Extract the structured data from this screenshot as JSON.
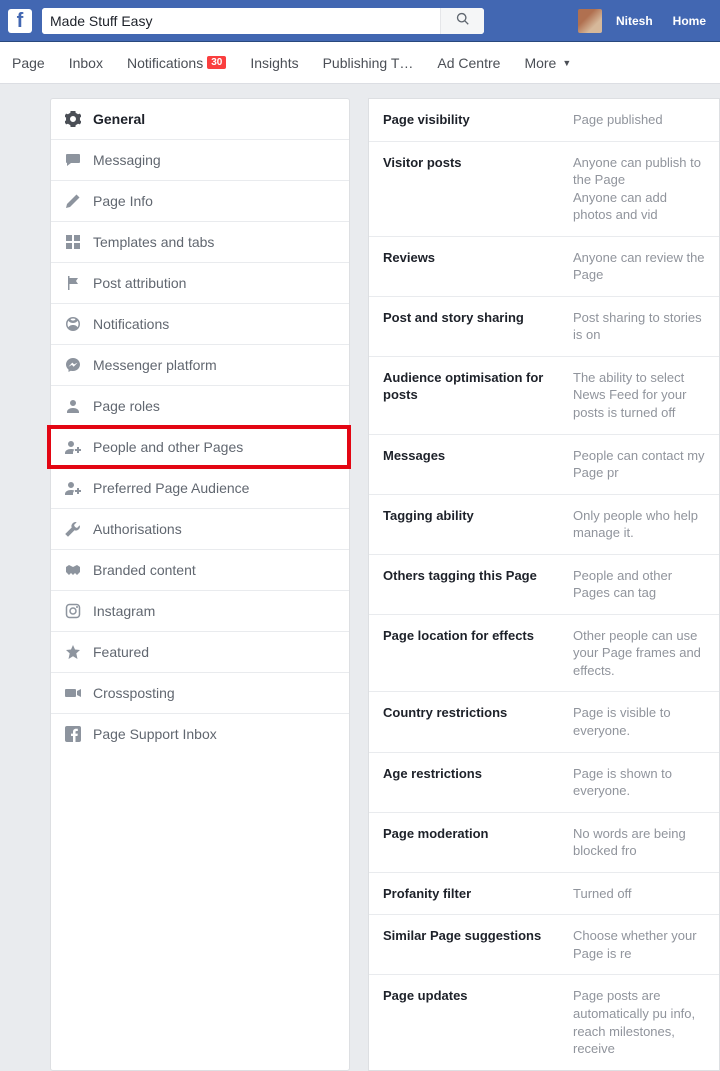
{
  "header": {
    "search_value": "Made Stuff Easy",
    "user_name": "Nitesh",
    "home_label": "Home"
  },
  "tabs": {
    "page": "Page",
    "inbox": "Inbox",
    "notifications": "Notifications",
    "notifications_badge": "30",
    "insights": "Insights",
    "publishing": "Publishing T…",
    "ad_centre": "Ad Centre",
    "more": "More"
  },
  "sidebar": [
    {
      "key": "general",
      "label": "General",
      "icon": "gear",
      "active": true
    },
    {
      "key": "messaging",
      "label": "Messaging",
      "icon": "chat"
    },
    {
      "key": "page-info",
      "label": "Page Info",
      "icon": "pencil"
    },
    {
      "key": "templates",
      "label": "Templates and tabs",
      "icon": "grid"
    },
    {
      "key": "post-attribution",
      "label": "Post attribution",
      "icon": "flag"
    },
    {
      "key": "notifications",
      "label": "Notifications",
      "icon": "globe"
    },
    {
      "key": "messenger-platform",
      "label": "Messenger platform",
      "icon": "messenger"
    },
    {
      "key": "page-roles",
      "label": "Page roles",
      "icon": "person"
    },
    {
      "key": "people-pages",
      "label": "People and other Pages",
      "icon": "person-plus",
      "highlight": true
    },
    {
      "key": "preferred-audience",
      "label": "Preferred Page Audience",
      "icon": "person-plus"
    },
    {
      "key": "authorisations",
      "label": "Authorisations",
      "icon": "wrench"
    },
    {
      "key": "branded-content",
      "label": "Branded content",
      "icon": "handshake"
    },
    {
      "key": "instagram",
      "label": "Instagram",
      "icon": "instagram"
    },
    {
      "key": "featured",
      "label": "Featured",
      "icon": "star"
    },
    {
      "key": "crossposting",
      "label": "Crossposting",
      "icon": "video"
    },
    {
      "key": "page-support",
      "label": "Page Support Inbox",
      "icon": "fb"
    }
  ],
  "settings_rows": [
    {
      "label": "Page visibility",
      "value": "Page published"
    },
    {
      "label": "Visitor posts",
      "value": "Anyone can publish to the Page\nAnyone can add photos and vid"
    },
    {
      "label": "Reviews",
      "value": "Anyone can review the Page"
    },
    {
      "label": "Post and story sharing",
      "value": "Post sharing to stories is on"
    },
    {
      "label": "Audience optimisation for posts",
      "value": "The ability to select News Feed for your posts is turned off"
    },
    {
      "label": "Messages",
      "value": "People can contact my Page pr"
    },
    {
      "label": "Tagging ability",
      "value": "Only people who help manage it."
    },
    {
      "label": "Others tagging this Page",
      "value": "People and other Pages can tag"
    },
    {
      "label": "Page location for effects",
      "value": "Other people can use your Page frames and effects."
    },
    {
      "label": "Country restrictions",
      "value": "Page is visible to everyone."
    },
    {
      "label": "Age restrictions",
      "value": "Page is shown to everyone."
    },
    {
      "label": "Page moderation",
      "value": "No words are being blocked fro"
    },
    {
      "label": "Profanity filter",
      "value": "Turned off"
    },
    {
      "label": "Similar Page suggestions",
      "value": "Choose whether your Page is re"
    },
    {
      "label": "Page updates",
      "value": "Page posts are automatically pu info, reach milestones, receive"
    }
  ]
}
